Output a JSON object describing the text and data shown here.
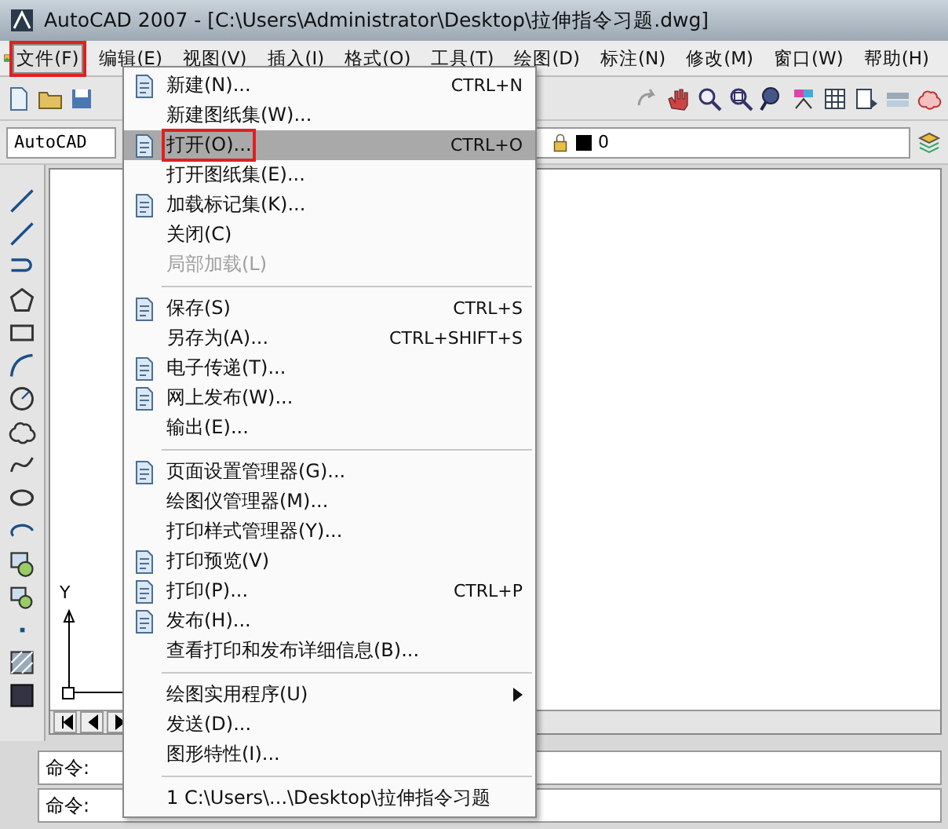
{
  "window": {
    "title": "AutoCAD 2007 - [C:\\Users\\Administrator\\Desktop\\拉伸指令习题.dwg]"
  },
  "menu_bar": [
    {
      "label": "文件(F)",
      "selected": true,
      "annotated": true
    },
    {
      "label": "编辑(E)",
      "selected": false,
      "annotated": false
    },
    {
      "label": "视图(V)",
      "selected": false,
      "annotated": false
    },
    {
      "label": "插入(I)",
      "selected": false,
      "annotated": false
    },
    {
      "label": "格式(O)",
      "selected": false,
      "annotated": false
    },
    {
      "label": "工具(T)",
      "selected": false,
      "annotated": false
    },
    {
      "label": "绘图(D)",
      "selected": false,
      "annotated": false
    },
    {
      "label": "标注(N)",
      "selected": false,
      "annotated": false
    },
    {
      "label": "修改(M)",
      "selected": false,
      "annotated": false
    },
    {
      "label": "窗口(W)",
      "selected": false,
      "annotated": false
    },
    {
      "label": "帮助(H)",
      "selected": false,
      "annotated": false
    }
  ],
  "styles_toolbar": {
    "workspace": "AutoCAD",
    "layer": "0"
  },
  "file_menu": [
    {
      "kind": "item",
      "label": "新建(N)...",
      "shortcut": "CTRL+N",
      "icon": true,
      "selected": false,
      "disabled": false,
      "annotated": false
    },
    {
      "kind": "item",
      "label": "新建图纸集(W)...",
      "icon": false,
      "selected": false,
      "disabled": false,
      "annotated": false
    },
    {
      "kind": "item",
      "label": "打开(O)...",
      "shortcut": "CTRL+O",
      "icon": true,
      "selected": true,
      "disabled": false,
      "annotated": true
    },
    {
      "kind": "item",
      "label": "打开图纸集(E)...",
      "icon": false,
      "selected": false,
      "disabled": false,
      "annotated": false
    },
    {
      "kind": "item",
      "label": "加载标记集(K)...",
      "icon": true,
      "selected": false,
      "disabled": false,
      "annotated": false
    },
    {
      "kind": "item",
      "label": "关闭(C)",
      "icon": false,
      "selected": false,
      "disabled": false,
      "annotated": false
    },
    {
      "kind": "item",
      "label": "局部加载(L)",
      "icon": false,
      "selected": false,
      "disabled": true,
      "annotated": false
    },
    {
      "kind": "separator"
    },
    {
      "kind": "item",
      "label": "保存(S)",
      "shortcut": "CTRL+S",
      "icon": true,
      "selected": false,
      "disabled": false,
      "annotated": false
    },
    {
      "kind": "item",
      "label": "另存为(A)...",
      "shortcut": "CTRL+SHIFT+S",
      "icon": false,
      "selected": false,
      "disabled": false,
      "annotated": false
    },
    {
      "kind": "item",
      "label": "电子传递(T)...",
      "icon": true,
      "selected": false,
      "disabled": false,
      "annotated": false
    },
    {
      "kind": "item",
      "label": "网上发布(W)...",
      "icon": true,
      "selected": false,
      "disabled": false,
      "annotated": false
    },
    {
      "kind": "item",
      "label": "输出(E)...",
      "icon": false,
      "selected": false,
      "disabled": false,
      "annotated": false
    },
    {
      "kind": "separator"
    },
    {
      "kind": "item",
      "label": "页面设置管理器(G)...",
      "icon": true,
      "selected": false,
      "disabled": false,
      "annotated": false
    },
    {
      "kind": "item",
      "label": "绘图仪管理器(M)...",
      "icon": false,
      "selected": false,
      "disabled": false,
      "annotated": false
    },
    {
      "kind": "item",
      "label": "打印样式管理器(Y)...",
      "icon": false,
      "selected": false,
      "disabled": false,
      "annotated": false
    },
    {
      "kind": "item",
      "label": "打印预览(V)",
      "icon": true,
      "selected": false,
      "disabled": false,
      "annotated": false
    },
    {
      "kind": "item",
      "label": "打印(P)...",
      "shortcut": "CTRL+P",
      "icon": true,
      "selected": false,
      "disabled": false,
      "annotated": false
    },
    {
      "kind": "item",
      "label": "发布(H)...",
      "icon": true,
      "selected": false,
      "disabled": false,
      "annotated": false
    },
    {
      "kind": "item",
      "label": "查看打印和发布详细信息(B)...",
      "icon": false,
      "selected": false,
      "disabled": false,
      "annotated": false
    },
    {
      "kind": "separator"
    },
    {
      "kind": "item",
      "label": "绘图实用程序(U)",
      "icon": false,
      "submenu": true,
      "selected": false,
      "disabled": false,
      "annotated": false
    },
    {
      "kind": "item",
      "label": "发送(D)...",
      "icon": false,
      "selected": false,
      "disabled": false,
      "annotated": false
    },
    {
      "kind": "item",
      "label": "图形特性(I)...",
      "icon": false,
      "selected": false,
      "disabled": false,
      "annotated": false
    },
    {
      "kind": "separator"
    },
    {
      "kind": "item",
      "label": "1 C:\\Users\\...\\Desktop\\拉伸指令习题",
      "icon": false,
      "selected": false,
      "disabled": false,
      "annotated": false
    }
  ],
  "ucs": {
    "y_axis": "Y"
  },
  "command_lines": [
    "命令:",
    "命令:"
  ]
}
